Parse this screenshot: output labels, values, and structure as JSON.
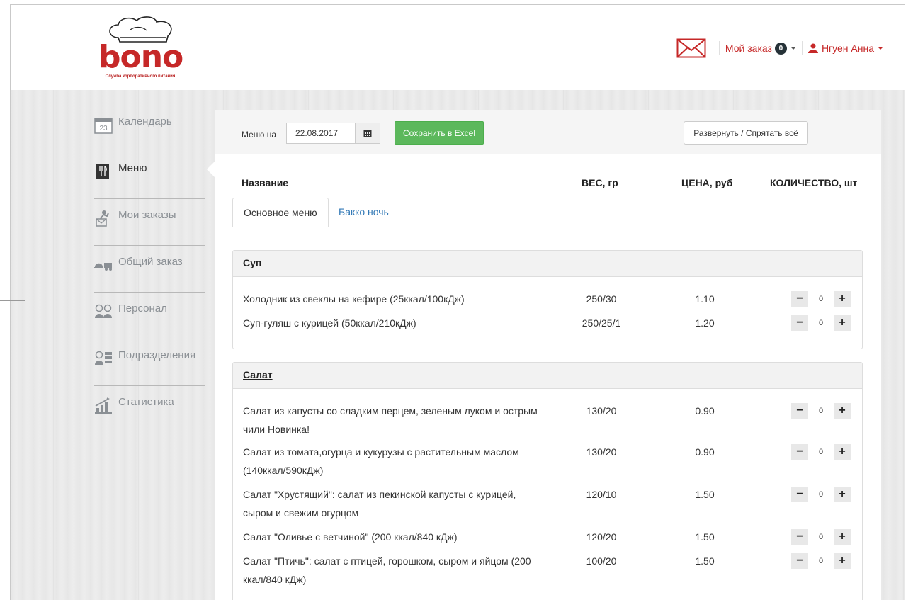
{
  "logo": {
    "word": "bono",
    "tagline": "Служба корпоративного питания"
  },
  "header": {
    "my_order_label": "Мой заказ",
    "my_order_count": "0",
    "user_name": "Нгуен Анна"
  },
  "sidebar": {
    "items": [
      {
        "label": "Календарь",
        "icon": "calendar-icon"
      },
      {
        "label": "Меню",
        "icon": "menu-icon",
        "active": true
      },
      {
        "label": "Мои заказы",
        "icon": "my-orders-icon"
      },
      {
        "label": "Общий заказ",
        "icon": "general-order-icon"
      },
      {
        "label": "Персонал",
        "icon": "staff-icon"
      },
      {
        "label": "Подразделения",
        "icon": "departments-icon"
      },
      {
        "label": "Статистика",
        "icon": "statistics-icon"
      }
    ],
    "calendar_day": "23"
  },
  "toolbar": {
    "menu_on_label": "Меню на",
    "date_value": "22.08.2017",
    "excel_button": "Сохранить в Excel",
    "toggle_button": "Развернуть / Спрятать всё"
  },
  "columns": {
    "name": "Название",
    "weight": "ВЕС, гр",
    "price": "ЦЕНА, руб",
    "quantity": "КОЛИЧЕСТВО, шт"
  },
  "tabs": [
    {
      "label": "Основное меню",
      "active": true
    },
    {
      "label": "Бакко ночь"
    }
  ],
  "sections": [
    {
      "title": "Суп",
      "items": [
        {
          "name": "Холодник из свеклы на кефире (25ккал/100кДж)",
          "weight": "250/30",
          "price": "1.10",
          "qty": "0"
        },
        {
          "name": "Суп-гуляш с курицей (50ккал/210кДж)",
          "weight": "250/25/1",
          "price": "1.20",
          "qty": "0"
        }
      ]
    },
    {
      "title": "Салат",
      "items": [
        {
          "name": "Салат из капусты со сладким перцем, зеленым луком и острым чили Новинка!",
          "weight": "130/20",
          "price": "0.90",
          "qty": "0"
        },
        {
          "name": "Салат из томата,огурца и кукурузы с растительным маслом (140ккал/590кДж)",
          "weight": "130/20",
          "price": "0.90",
          "qty": "0"
        },
        {
          "name": "Салат \"Хрустящий\": салат из пекинской капусты с курицей, сыром и свежим огурцом",
          "weight": "120/10",
          "price": "1.50",
          "qty": "0"
        },
        {
          "name": "Салат \"Оливье с ветчиной\" (200 ккал/840 кДж)",
          "weight": "120/20",
          "price": "1.50",
          "qty": "0"
        },
        {
          "name": "Салат \"Птичь\": салат с птицей, горошком, сыром и яйцом (200 ккал/840 кДж)",
          "weight": "100/20",
          "price": "1.50",
          "qty": "0"
        }
      ]
    }
  ],
  "stepper": {
    "minus": "−",
    "plus": "+"
  },
  "colors": {
    "brand": "#c62828",
    "success": "#5cb85c",
    "link": "#337ab7"
  }
}
